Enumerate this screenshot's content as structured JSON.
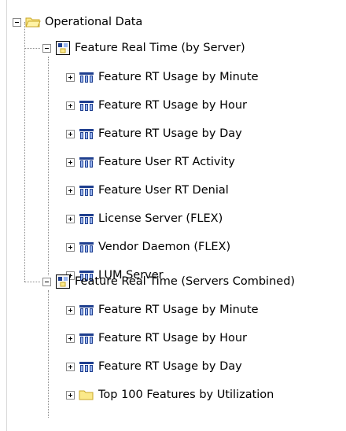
{
  "tree": {
    "root": {
      "label": "Operational Data",
      "icon": "folder-open-icon",
      "expanded": true
    },
    "groups": [
      {
        "label": "Feature Real Time (by Server)",
        "icon": "report-group-icon",
        "expanded": true,
        "items": [
          {
            "label": "Feature RT Usage by Minute",
            "icon": "cube-icon"
          },
          {
            "label": "Feature RT Usage by Hour",
            "icon": "cube-icon"
          },
          {
            "label": "Feature RT Usage by Day",
            "icon": "cube-icon"
          },
          {
            "label": "Feature User RT Activity",
            "icon": "cube-icon"
          },
          {
            "label": "Feature User RT Denial",
            "icon": "cube-icon"
          },
          {
            "label": "License Server (FLEX)",
            "icon": "cube-icon"
          },
          {
            "label": "Vendor Daemon (FLEX)",
            "icon": "cube-icon"
          },
          {
            "label": "LUM Server",
            "icon": "cube-icon"
          }
        ]
      },
      {
        "label": "Feature Real Time (Servers Combined)",
        "icon": "report-group-icon",
        "expanded": true,
        "items": [
          {
            "label": "Feature RT Usage by Minute",
            "icon": "cube-icon"
          },
          {
            "label": "Feature RT Usage by Hour",
            "icon": "cube-icon"
          },
          {
            "label": "Feature RT Usage by Day",
            "icon": "cube-icon"
          },
          {
            "label": "Top 100 Features by Utilization",
            "icon": "folder-icon"
          }
        ]
      }
    ]
  },
  "colors": {
    "folder_fill": "#fbe98a",
    "folder_stroke": "#c9a72a",
    "cube_dark": "#1f3f8f",
    "cube_light": "#9ab6f0"
  }
}
